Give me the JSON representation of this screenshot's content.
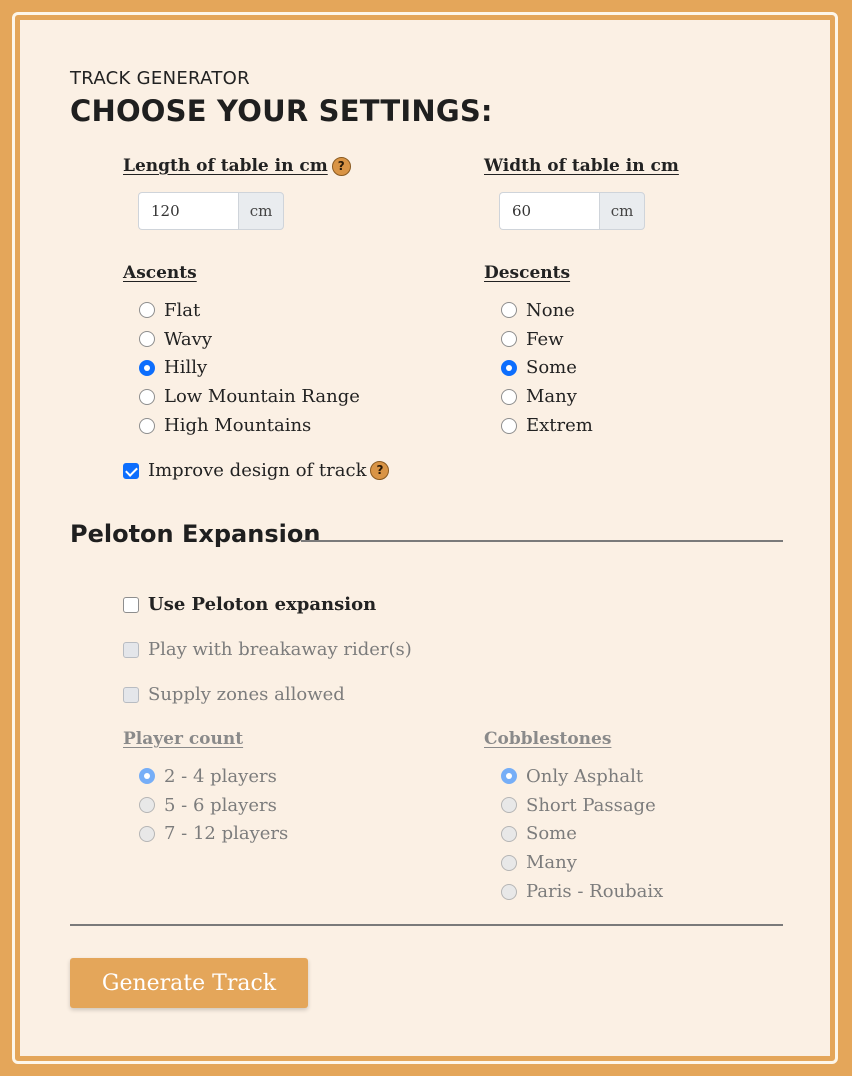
{
  "header": {
    "eyebrow": "TRACK GENERATOR",
    "title": "CHOOSE YOUR SETTINGS:"
  },
  "length": {
    "label": "Length of table in cm",
    "value": "120",
    "unit": "cm",
    "help": "?"
  },
  "width": {
    "label": "Width of table in cm",
    "value": "60",
    "unit": "cm"
  },
  "ascents": {
    "label": "Ascents",
    "options": [
      "Flat",
      "Wavy",
      "Hilly",
      "Low Mountain Range",
      "High Mountains"
    ],
    "selected": "Hilly"
  },
  "descents": {
    "label": "Descents",
    "options": [
      "None",
      "Few",
      "Some",
      "Many",
      "Extrem"
    ],
    "selected": "Some"
  },
  "improve": {
    "label": "Improve design of track",
    "checked": true,
    "help": "?"
  },
  "peloton": {
    "title": "Peloton Expansion",
    "use_label": "Use Peloton expansion",
    "breakaway_label": "Play with breakaway rider(s)",
    "supply_label": "Supply zones allowed",
    "player_count": {
      "label": "Player count",
      "options": [
        "2 - 4 players",
        "5 - 6 players",
        "7 - 12 players"
      ],
      "selected": "2 - 4 players"
    },
    "cobblestones": {
      "label": "Cobblestones",
      "options": [
        "Only Asphalt",
        "Short Passage",
        "Some",
        "Many",
        "Paris - Roubaix"
      ],
      "selected": "Only Asphalt"
    }
  },
  "generate_label": "Generate Track",
  "colors": {
    "accent": "#e4a65a",
    "card": "#fbf0e4",
    "radio_blue": "#0d6efd"
  }
}
